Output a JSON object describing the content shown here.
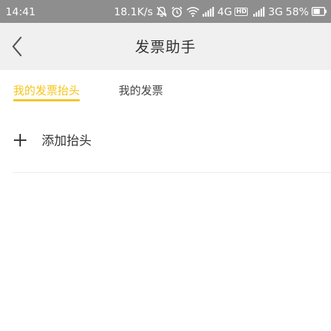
{
  "status_bar": {
    "time": "14:41",
    "network_speed": "18.1K/s",
    "signal1_label": "4G",
    "hd_label": "HD",
    "signal2_label": "3G",
    "battery": "58%",
    "icons": [
      "bell-off-icon",
      "alarm-icon",
      "wifi-icon",
      "signal-icon",
      "signal-icon",
      "battery-icon"
    ]
  },
  "nav": {
    "title": "发票助手",
    "back_icon": "chevron-left-icon"
  },
  "tabs": [
    {
      "label": "我的发票抬头",
      "active": true
    },
    {
      "label": "我的发票",
      "active": false
    }
  ],
  "add_row": {
    "label": "添加抬头",
    "icon": "plus-icon"
  },
  "colors": {
    "accent": "#f5c518",
    "status_bar_bg": "#8e8e8e",
    "nav_bg": "#f0f0f0"
  }
}
